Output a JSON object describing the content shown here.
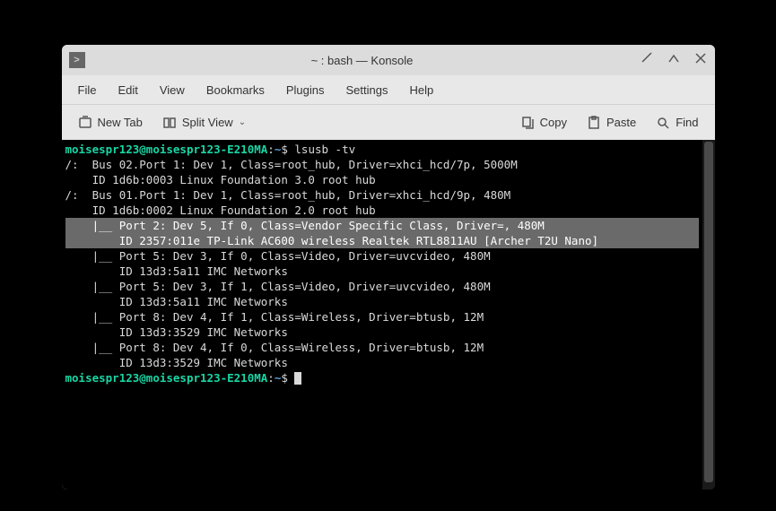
{
  "titlebar": {
    "title": "~ : bash — Konsole"
  },
  "menubar": {
    "file": "File",
    "edit": "Edit",
    "view": "View",
    "bookmarks": "Bookmarks",
    "plugins": "Plugins",
    "settings": "Settings",
    "help": "Help"
  },
  "toolbar": {
    "new_tab": "New Tab",
    "split_view": "Split View",
    "copy": "Copy",
    "paste": "Paste",
    "find": "Find"
  },
  "terminal": {
    "prompt_user": "moisespr123@moisespr123-E210MA",
    "prompt_sep": ":",
    "prompt_path": "~",
    "prompt_dollar": "$",
    "command": " lsusb -tv",
    "lines": [
      "/:  Bus 02.Port 1: Dev 1, Class=root_hub, Driver=xhci_hcd/7p, 5000M",
      "    ID 1d6b:0003 Linux Foundation 3.0 root hub",
      "/:  Bus 01.Port 1: Dev 1, Class=root_hub, Driver=xhci_hcd/9p, 480M",
      "    ID 1d6b:0002 Linux Foundation 2.0 root hub",
      "    |__ Port 2: Dev 5, If 0, Class=Vendor Specific Class, Driver=, 480M",
      "        ID 2357:011e TP-Link AC600 wireless Realtek RTL8811AU [Archer T2U Nano]",
      "    |__ Port 5: Dev 3, If 0, Class=Video, Driver=uvcvideo, 480M",
      "        ID 13d3:5a11 IMC Networks",
      "    |__ Port 5: Dev 3, If 1, Class=Video, Driver=uvcvideo, 480M",
      "        ID 13d3:5a11 IMC Networks",
      "    |__ Port 8: Dev 4, If 1, Class=Wireless, Driver=btusb, 12M",
      "        ID 13d3:3529 IMC Networks",
      "    |__ Port 8: Dev 4, If 0, Class=Wireless, Driver=btusb, 12M",
      "        ID 13d3:3529 IMC Networks"
    ],
    "highlighted_indices": [
      4,
      5
    ]
  }
}
